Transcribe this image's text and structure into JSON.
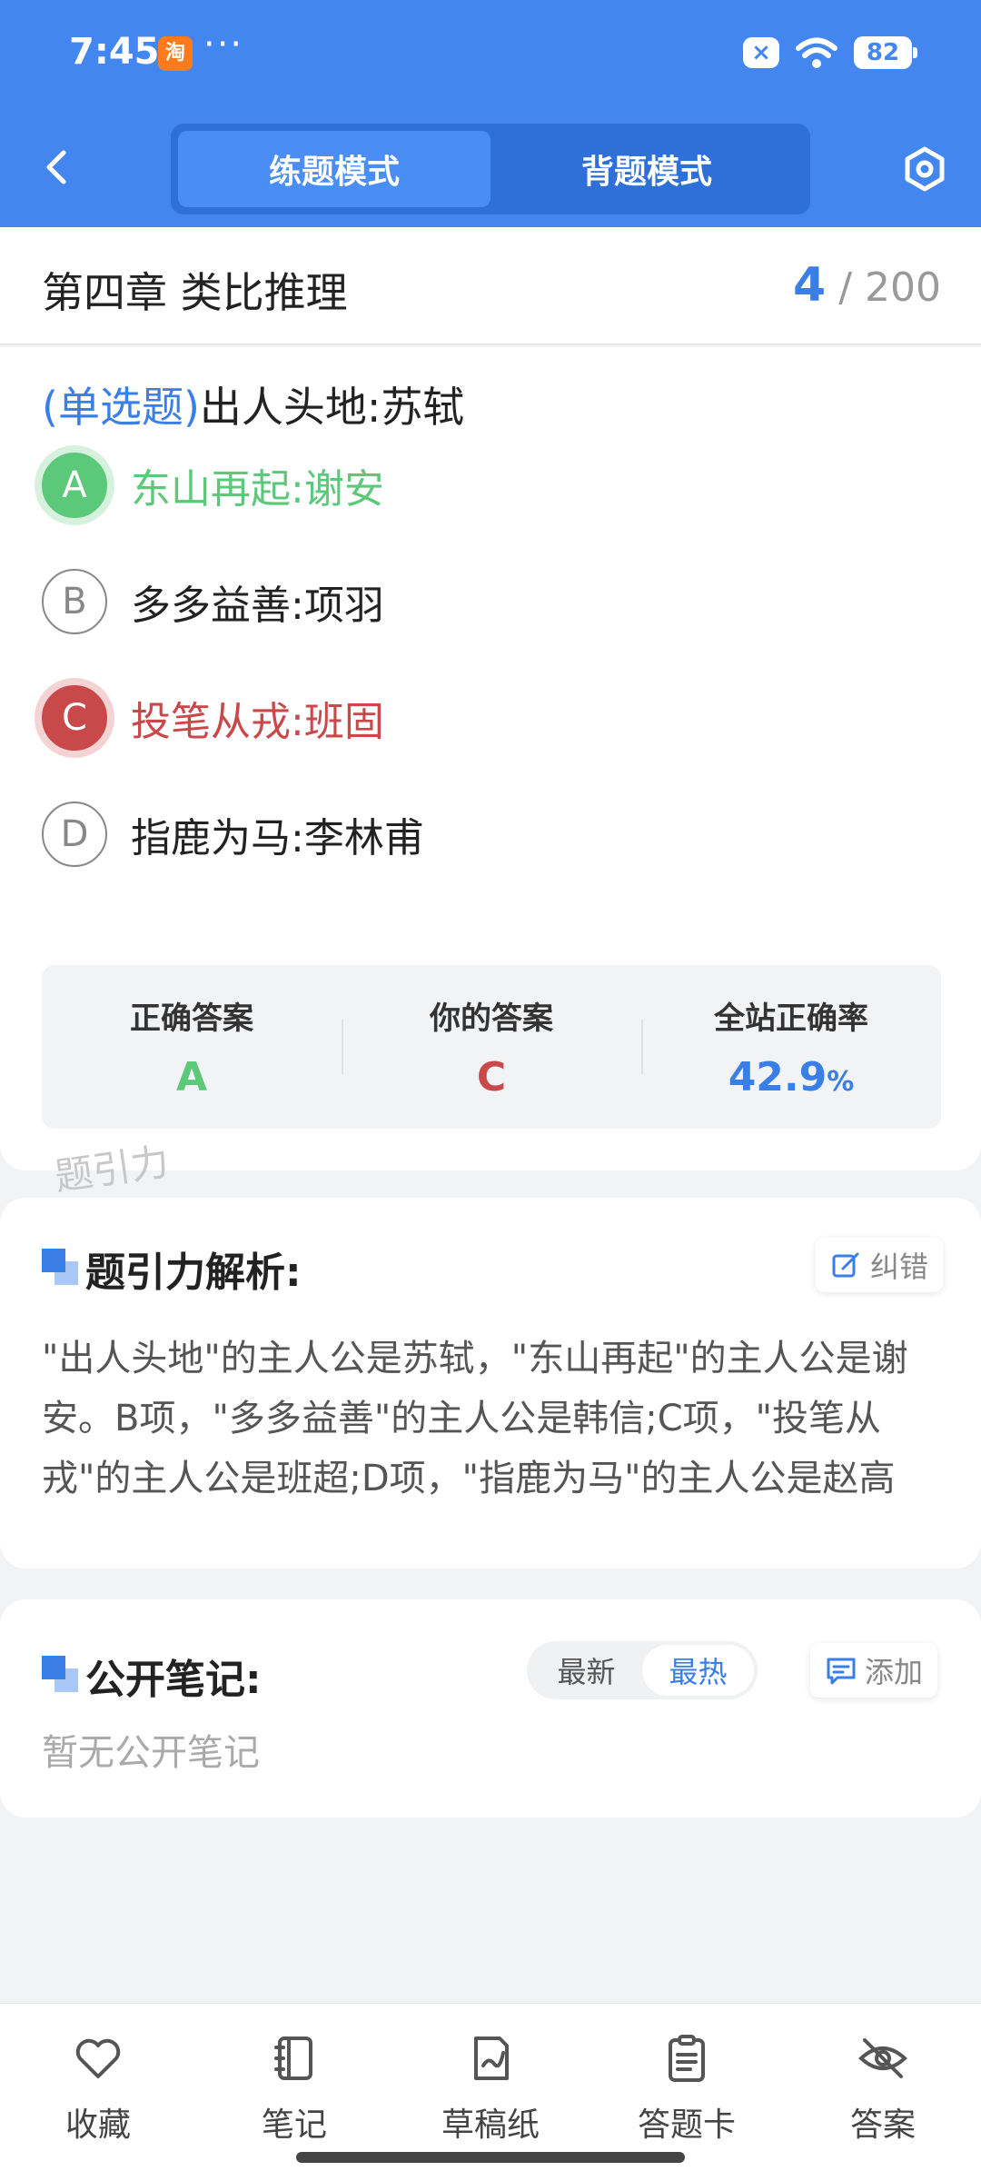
{
  "status_bar": {
    "time": "7:45",
    "app_badge": "淘",
    "more": "···",
    "battery": "82"
  },
  "header": {
    "tabs": [
      {
        "label": "练题模式",
        "active": true
      },
      {
        "label": "背题模式",
        "active": false
      }
    ],
    "back_icon": "chevron-left-icon",
    "settings_icon": "hexagon-settings-icon"
  },
  "chapter": {
    "title": "第四章 类比推理",
    "current": "4",
    "total": "/ 200"
  },
  "question": {
    "type": "(单选题)",
    "stem": "出人头地:苏轼",
    "options": [
      {
        "letter": "A",
        "text": "东山再起:谢安",
        "state": "correct"
      },
      {
        "letter": "B",
        "text": "多多益善:项羽",
        "state": "normal"
      },
      {
        "letter": "C",
        "text": "投笔从戎:班固",
        "state": "wrong"
      },
      {
        "letter": "D",
        "text": "指鹿为马:李林甫",
        "state": "normal"
      }
    ]
  },
  "summary": {
    "correct_label": "正确答案",
    "correct_value": "A",
    "yours_label": "你的答案",
    "yours_value": "C",
    "rate_label": "全站正确率",
    "rate_value": "42.9",
    "rate_unit": "%"
  },
  "watermark": "题引力",
  "analysis": {
    "title": "题引力解析:",
    "report_label": "纠错",
    "text": "\"出人头地\"的主人公是苏轼，\"东山再起\"的主人公是谢安。B项，\"多多益善\"的主人公是韩信;C项，\"投笔从戎\"的主人公是班超;D项，\"指鹿为马\"的主人公是赵高"
  },
  "notes": {
    "title": "公开笔记:",
    "sort_newest": "最新",
    "sort_hottest": "最热",
    "add_label": "添加",
    "empty_text": "暂无公开笔记"
  },
  "bottom_nav": [
    {
      "label": "收藏",
      "icon": "heart-icon"
    },
    {
      "label": "笔记",
      "icon": "notebook-icon"
    },
    {
      "label": "草稿纸",
      "icon": "draft-pen-icon"
    },
    {
      "label": "答题卡",
      "icon": "clipboard-icon"
    },
    {
      "label": "答案",
      "icon": "eye-off-icon"
    }
  ],
  "colors": {
    "primary": "#4386f0",
    "correct": "#5cc879",
    "wrong": "#c9484a",
    "accent_text": "#3a7ee8"
  }
}
